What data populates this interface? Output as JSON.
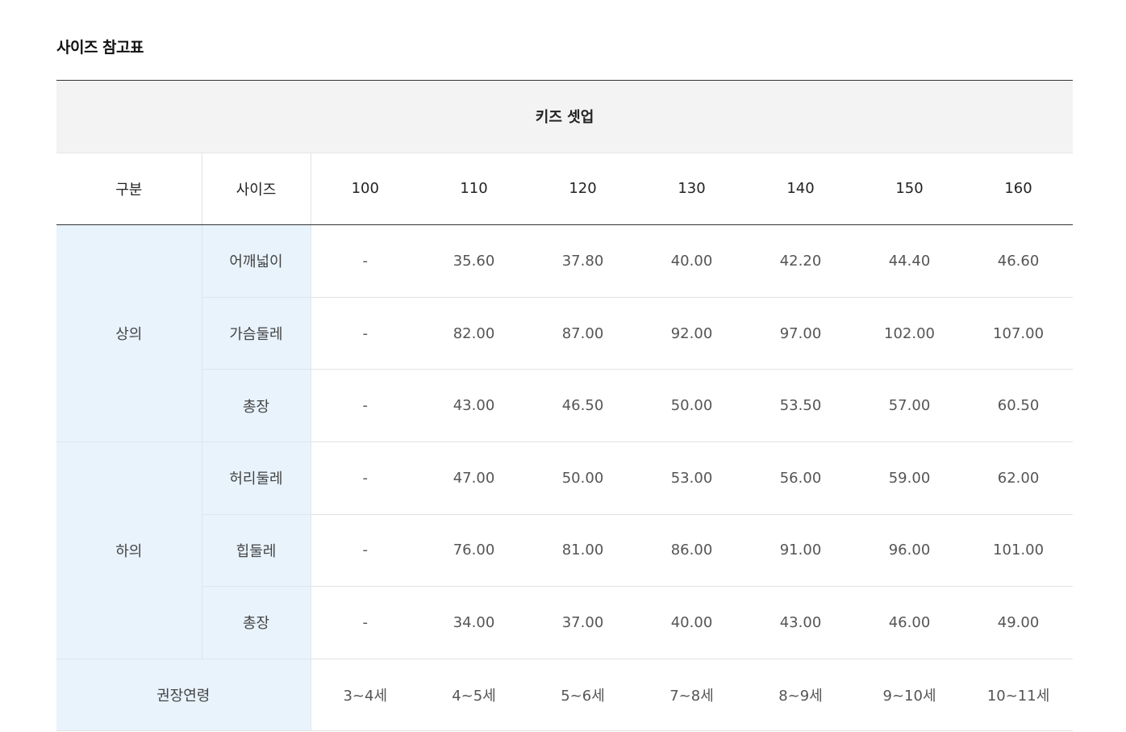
{
  "page_title": "사이즈 참고표",
  "table": {
    "caption": "키즈 셋업",
    "header": {
      "category": "구분",
      "size": "사이즈",
      "sizes": [
        "100",
        "110",
        "120",
        "130",
        "140",
        "150",
        "160"
      ]
    },
    "groups": [
      {
        "category": "상의",
        "rows": [
          {
            "item": "어깨넓이",
            "values": [
              "-",
              "35.60",
              "37.80",
              "40.00",
              "42.20",
              "44.40",
              "46.60"
            ]
          },
          {
            "item": "가슴둘레",
            "values": [
              "-",
              "82.00",
              "87.00",
              "92.00",
              "97.00",
              "102.00",
              "107.00"
            ]
          },
          {
            "item": "총장",
            "values": [
              "-",
              "43.00",
              "46.50",
              "50.00",
              "53.50",
              "57.00",
              "60.50"
            ]
          }
        ]
      },
      {
        "category": "하의",
        "rows": [
          {
            "item": "허리둘레",
            "values": [
              "-",
              "47.00",
              "50.00",
              "53.00",
              "56.00",
              "59.00",
              "62.00"
            ]
          },
          {
            "item": "힙둘레",
            "values": [
              "-",
              "76.00",
              "81.00",
              "86.00",
              "91.00",
              "96.00",
              "101.00"
            ]
          },
          {
            "item": "총장",
            "values": [
              "-",
              "34.00",
              "37.00",
              "40.00",
              "43.00",
              "46.00",
              "49.00"
            ]
          }
        ]
      }
    ],
    "age_row": {
      "label": "권장연령",
      "values": [
        "3~4세",
        "4~5세",
        "5~6세",
        "7~8세",
        "8~9세",
        "9~10세",
        "10~11세"
      ]
    }
  }
}
